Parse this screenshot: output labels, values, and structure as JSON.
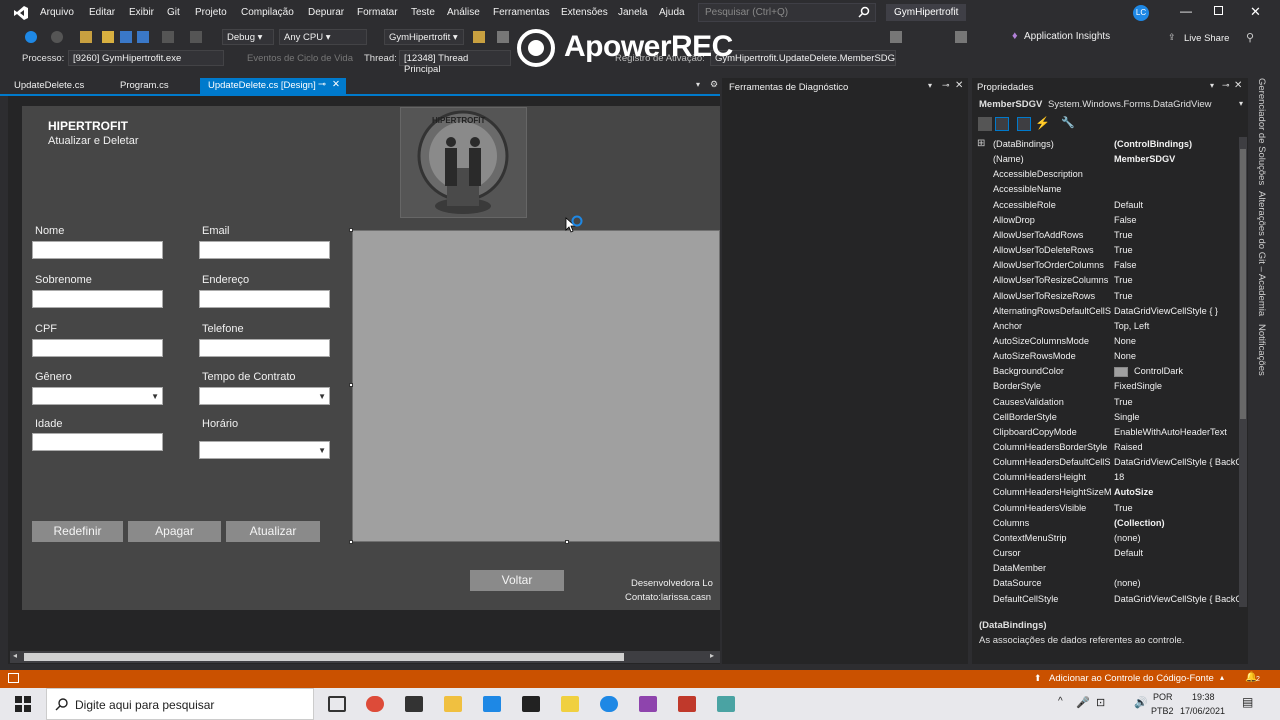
{
  "menubar": {
    "items": [
      "Arquivo",
      "Editar",
      "Exibir",
      "Git",
      "Projeto",
      "Compilação",
      "Depurar",
      "Formatar",
      "Teste",
      "Análise",
      "Ferramentas",
      "Extensões",
      "Janela",
      "Ajuda"
    ],
    "search_placeholder": "Pesquisar (Ctrl+Q)",
    "solution_name": "GymHipertrofit",
    "user_initials": "LC"
  },
  "toolbar": {
    "config": "Debug",
    "platform": "Any CPU",
    "startup": "GymHipertrofit",
    "app_insights": "Application Insights",
    "live_share": "Live Share"
  },
  "procbar": {
    "process_label": "Processo:",
    "process_value": "[9260] GymHipertrofit.exe",
    "lifecycle": "Eventos de Ciclo de Vida",
    "thread_label": "Thread:",
    "thread_value": "[12348] Thread Principal",
    "trace_label": "Registro de Ativação:",
    "trace_value": "GymHipertrofit.UpdateDelete.MemberSDG"
  },
  "watermark": "ApowerREC",
  "tabs": [
    "UpdateDelete.cs",
    "Program.cs",
    "UpdateDelete.cs [Design]"
  ],
  "form": {
    "title": "HIPERTROFIT",
    "subtitle": "Atualizar e Deletar",
    "logo_text": "HIPERTROFIT",
    "labels": {
      "nome": "Nome",
      "email": "Email",
      "sobrenome": "Sobrenome",
      "endereco": "Endereço",
      "cpf": "CPF",
      "telefone": "Telefone",
      "genero": "Gênero",
      "tempo": "Tempo de Contrato",
      "idade": "Idade",
      "horario": "Horário"
    },
    "buttons": {
      "redefinir": "Redefinir",
      "apagar": "Apagar",
      "atualizar": "Atualizar",
      "voltar": "Voltar"
    },
    "footer_dev": "Desenvolvedora Lo",
    "footer_contact": "Contato:larissa.casn"
  },
  "diagnostics": {
    "title": "Ferramentas de Diagnóstico"
  },
  "properties": {
    "title": "Propriedades",
    "object_name": "MemberSDGV",
    "object_type": "System.Windows.Forms.DataGridView",
    "rows": [
      {
        "name": "(DataBindings)",
        "value": "(ControlBindings)",
        "bold": true
      },
      {
        "name": "(Name)",
        "value": "MemberSDGV",
        "bold": true
      },
      {
        "name": "AccessibleDescription",
        "value": ""
      },
      {
        "name": "AccessibleName",
        "value": ""
      },
      {
        "name": "AccessibleRole",
        "value": "Default"
      },
      {
        "name": "AllowDrop",
        "value": "False"
      },
      {
        "name": "AllowUserToAddRows",
        "value": "True"
      },
      {
        "name": "AllowUserToDeleteRows",
        "value": "True"
      },
      {
        "name": "AllowUserToOrderColumns",
        "value": "False"
      },
      {
        "name": "AllowUserToResizeColumns",
        "value": "True"
      },
      {
        "name": "AllowUserToResizeRows",
        "value": "True"
      },
      {
        "name": "AlternatingRowsDefaultCellS",
        "value": "DataGridViewCellStyle { }"
      },
      {
        "name": "Anchor",
        "value": "Top, Left"
      },
      {
        "name": "AutoSizeColumnsMode",
        "value": "None"
      },
      {
        "name": "AutoSizeRowsMode",
        "value": "None"
      },
      {
        "name": "BackgroundColor",
        "value": "ControlDark",
        "swatch": "#a0a0a0"
      },
      {
        "name": "BorderStyle",
        "value": "FixedSingle"
      },
      {
        "name": "CausesValidation",
        "value": "True"
      },
      {
        "name": "CellBorderStyle",
        "value": "Single"
      },
      {
        "name": "ClipboardCopyMode",
        "value": "EnableWithAutoHeaderText"
      },
      {
        "name": "ColumnHeadersBorderStyle",
        "value": "Raised"
      },
      {
        "name": "ColumnHeadersDefaultCellS",
        "value": "DataGridViewCellStyle { BackC"
      },
      {
        "name": "ColumnHeadersHeight",
        "value": "18"
      },
      {
        "name": "ColumnHeadersHeightSizeM",
        "value": "AutoSize",
        "bold": true
      },
      {
        "name": "ColumnHeadersVisible",
        "value": "True"
      },
      {
        "name": "Columns",
        "value": "(Collection)",
        "bold": true
      },
      {
        "name": "ContextMenuStrip",
        "value": "(none)"
      },
      {
        "name": "Cursor",
        "value": "Default"
      },
      {
        "name": "DataMember",
        "value": ""
      },
      {
        "name": "DataSource",
        "value": "(none)"
      },
      {
        "name": "DefaultCellStyle",
        "value": "DataGridViewCellStyle { BackC"
      }
    ],
    "desc_title": "(DataBindings)",
    "desc_text": "As associações de dados referentes ao controle."
  },
  "rightrail": [
    "Gerenciador de Soluções",
    "Alterações do Git – Academia",
    "Notificações"
  ],
  "statusbar": {
    "source_control": "Adicionar ao Controle do Código-Fonte",
    "notif_count": "2"
  },
  "taskbar": {
    "search_placeholder": "Digite aqui para pesquisar",
    "lang1": "POR",
    "lang2": "PTB2",
    "time": "19:38",
    "date": "17/06/2021"
  },
  "colors": {
    "accent": "#007acc",
    "status": "#ca5100"
  }
}
